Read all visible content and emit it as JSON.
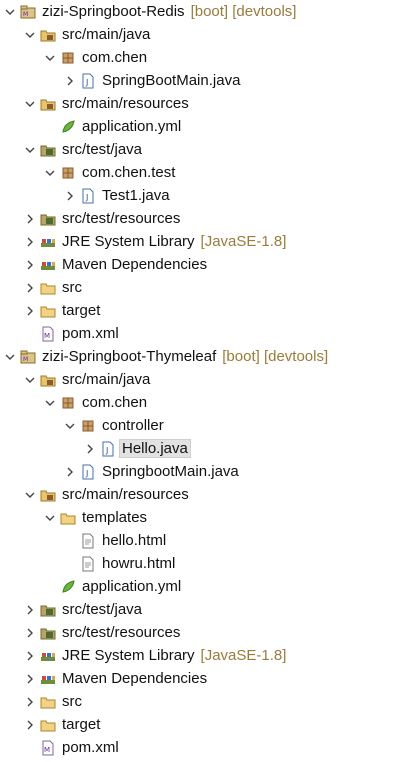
{
  "tree": [
    {
      "depth": 0,
      "twisty": "expanded",
      "icon": "maven-project-icon",
      "label": "zizi-Springboot-Redis",
      "decor": "[boot] [devtools]"
    },
    {
      "depth": 1,
      "twisty": "expanded",
      "icon": "source-folder-icon",
      "label": "src/main/java"
    },
    {
      "depth": 2,
      "twisty": "expanded",
      "icon": "package-icon",
      "label": "com.chen"
    },
    {
      "depth": 3,
      "twisty": "collapsed",
      "icon": "java-file-icon",
      "label": "SpringBootMain.java"
    },
    {
      "depth": 1,
      "twisty": "expanded",
      "icon": "source-folder-icon",
      "label": "src/main/resources"
    },
    {
      "depth": 2,
      "twisty": "none",
      "icon": "spring-yml-icon",
      "label": "application.yml"
    },
    {
      "depth": 1,
      "twisty": "expanded",
      "icon": "test-source-folder-icon",
      "label": "src/test/java"
    },
    {
      "depth": 2,
      "twisty": "expanded",
      "icon": "package-icon",
      "label": "com.chen.test"
    },
    {
      "depth": 3,
      "twisty": "collapsed",
      "icon": "java-file-icon",
      "label": "Test1.java"
    },
    {
      "depth": 1,
      "twisty": "collapsed",
      "icon": "test-source-folder-icon",
      "label": "src/test/resources"
    },
    {
      "depth": 1,
      "twisty": "collapsed",
      "icon": "library-icon",
      "label": "JRE System Library",
      "decor": "[JavaSE-1.8]"
    },
    {
      "depth": 1,
      "twisty": "collapsed",
      "icon": "library-icon",
      "label": "Maven Dependencies"
    },
    {
      "depth": 1,
      "twisty": "collapsed",
      "icon": "folder-icon",
      "label": "src"
    },
    {
      "depth": 1,
      "twisty": "collapsed",
      "icon": "folder-icon",
      "label": "target"
    },
    {
      "depth": 1,
      "twisty": "none",
      "icon": "maven-pom-icon",
      "label": "pom.xml"
    },
    {
      "depth": 0,
      "twisty": "expanded",
      "icon": "maven-project-icon",
      "label": "zizi-Springboot-Thymeleaf",
      "decor": "[boot] [devtools]"
    },
    {
      "depth": 1,
      "twisty": "expanded",
      "icon": "source-folder-icon",
      "label": "src/main/java"
    },
    {
      "depth": 2,
      "twisty": "expanded",
      "icon": "package-icon",
      "label": "com.chen"
    },
    {
      "depth": 3,
      "twisty": "expanded",
      "icon": "package-icon",
      "label": "controller"
    },
    {
      "depth": 4,
      "twisty": "collapsed",
      "icon": "java-file-icon",
      "label": "Hello.java",
      "selected": true
    },
    {
      "depth": 3,
      "twisty": "collapsed",
      "icon": "java-file-icon",
      "label": "SpringbootMain.java"
    },
    {
      "depth": 1,
      "twisty": "expanded",
      "icon": "source-folder-icon",
      "label": "src/main/resources"
    },
    {
      "depth": 2,
      "twisty": "expanded",
      "icon": "folder-icon",
      "label": "templates"
    },
    {
      "depth": 3,
      "twisty": "none",
      "icon": "html-file-icon",
      "label": "hello.html"
    },
    {
      "depth": 3,
      "twisty": "none",
      "icon": "html-file-icon",
      "label": "howru.html"
    },
    {
      "depth": 2,
      "twisty": "none",
      "icon": "spring-yml-icon",
      "label": "application.yml"
    },
    {
      "depth": 1,
      "twisty": "collapsed",
      "icon": "test-source-folder-icon",
      "label": "src/test/java"
    },
    {
      "depth": 1,
      "twisty": "collapsed",
      "icon": "test-source-folder-icon",
      "label": "src/test/resources"
    },
    {
      "depth": 1,
      "twisty": "collapsed",
      "icon": "library-icon",
      "label": "JRE System Library",
      "decor": "[JavaSE-1.8]"
    },
    {
      "depth": 1,
      "twisty": "collapsed",
      "icon": "library-icon",
      "label": "Maven Dependencies"
    },
    {
      "depth": 1,
      "twisty": "collapsed",
      "icon": "folder-icon",
      "label": "src"
    },
    {
      "depth": 1,
      "twisty": "collapsed",
      "icon": "folder-icon",
      "label": "target"
    },
    {
      "depth": 1,
      "twisty": "none",
      "icon": "maven-pom-icon",
      "label": "pom.xml"
    }
  ],
  "colors": {
    "decoration": "#9a7b3a",
    "folder": "#e8c46a",
    "package": "#b98a4a",
    "selection": "#e2e2e2"
  }
}
